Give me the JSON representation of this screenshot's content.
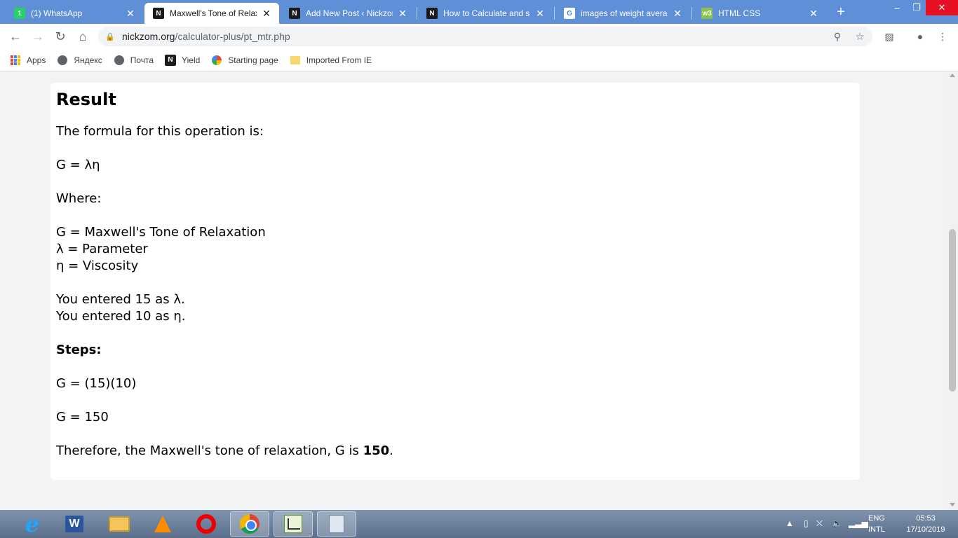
{
  "browser": {
    "tabs": [
      {
        "title": "(1) WhatsApp",
        "favicon": "whatsapp-icon",
        "active": false
      },
      {
        "title": "Maxwell's Tone of Relaxation",
        "favicon": "nickzom-icon",
        "active": true
      },
      {
        "title": "Add New Post ‹ Nickzom",
        "favicon": "nickzom-icon",
        "active": false
      },
      {
        "title": "How to Calculate and solve",
        "favicon": "nickzom-icon",
        "active": false
      },
      {
        "title": "images of weight average",
        "favicon": "google-icon",
        "active": false
      },
      {
        "title": "HTML CSS",
        "favicon": "w3-icon",
        "active": false
      }
    ],
    "url_domain": "nickzom.org",
    "url_path": "/calculator-plus/pt_mtr.php",
    "bookmarks": [
      {
        "label": "Apps",
        "icon": "apps-grid-icon"
      },
      {
        "label": "Яндекс",
        "icon": "globe-icon"
      },
      {
        "label": "Почта",
        "icon": "globe-icon"
      },
      {
        "label": "Yield",
        "icon": "yield-icon"
      },
      {
        "label": "Starting page",
        "icon": "starting-page-icon"
      },
      {
        "label": "Imported From IE",
        "icon": "folder-icon"
      }
    ]
  },
  "result": {
    "heading": "Result",
    "formula_intro": "The formula for this operation is:",
    "formula": "G = λη",
    "where_label": "Where:",
    "definitions": [
      "G = Maxwell's Tone of Relaxation",
      "λ = Parameter",
      "η = Viscosity"
    ],
    "entered": [
      "You entered 15 as λ.",
      "You entered 10 as η."
    ],
    "steps_label": "Steps:",
    "step_1": "G = (15)(10)",
    "step_2": "G = 150",
    "conclusion_prefix": "Therefore, the Maxwell's tone of relaxation, G is ",
    "conclusion_value": "150",
    "conclusion_suffix": "."
  },
  "taskbar": {
    "lang_top": "ENG",
    "lang_bottom": "INTL",
    "time": "05:53",
    "date": "17/10/2019"
  }
}
